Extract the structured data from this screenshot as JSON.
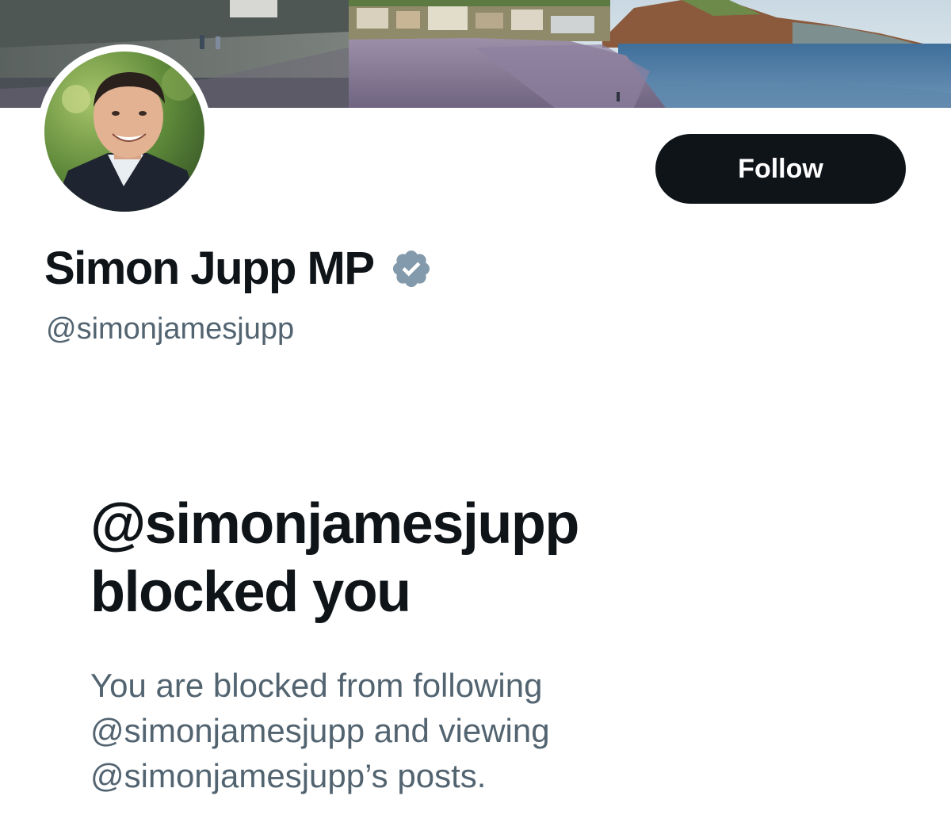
{
  "profile": {
    "display_name": "Simon Jupp MP",
    "handle": "@simonjamesjupp",
    "verified": true,
    "follow_label": "Follow"
  },
  "blocked_notice": {
    "title_line1": "@simonjamesjupp",
    "title_line2": "blocked you",
    "desc_line1": "You are blocked from following",
    "desc_line2": "@simonjamesjupp and viewing",
    "desc_line3": "@simonjamesjupp’s posts."
  },
  "colors": {
    "button_bg": "#0f1419",
    "secondary_text": "#536471",
    "verified_badge": "#829aab"
  },
  "icons": {
    "verified": "verified-badge-icon"
  }
}
